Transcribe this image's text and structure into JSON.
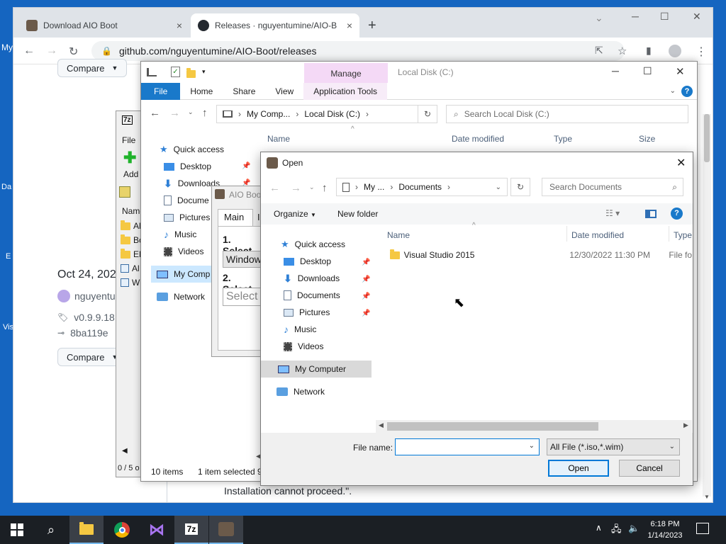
{
  "desktop": {
    "labels": [
      "My",
      "Da",
      "E",
      "Vis"
    ]
  },
  "chrome": {
    "tabs": [
      {
        "title": "Download AIO Boot",
        "close": "×"
      },
      {
        "title": "Releases · nguyentumine/AIO-Bo",
        "close": "×"
      }
    ],
    "new_tab": "+",
    "url": "github.com/nguyentumine/AIO-Boot/releases",
    "window_controls": {
      "min": "─",
      "max": "☐",
      "close": "✕",
      "tabsearch": "⌄"
    },
    "page": {
      "compare_label": "Compare",
      "date": "Oct 24, 2020",
      "author": "nguyentu",
      "tag": "v0.9.9.18",
      "commit": "8ba119e",
      "bottom_text": "Installation cannot proceed.\"."
    }
  },
  "explorer": {
    "title": "Local Disk (C:)",
    "manage_label": "Manage",
    "ribbon_tabs": [
      "File",
      "Home",
      "Share",
      "View",
      "Application Tools"
    ],
    "path": [
      "My Comp...",
      "Local Disk (C:)"
    ],
    "search_placeholder": "Search Local Disk (C:)",
    "columns": [
      "Name",
      "Date modified",
      "Type",
      "Size"
    ],
    "nav": [
      "Quick access",
      "Desktop",
      "Downloads",
      "Docume",
      "Pictures",
      "Music",
      "Videos",
      "My Comp",
      "Network"
    ],
    "status": {
      "items": "10 items",
      "selected": "1 item selected",
      "trail": "9"
    }
  },
  "sevenz": {
    "title_glyph": "7z",
    "menu_file": "File",
    "add_label": "Add",
    "col_name": "Name",
    "rows": [
      "Al",
      "Bo",
      "EF",
      "Al",
      "W"
    ],
    "status": "0 / 5 o"
  },
  "aio": {
    "title": "AIO Boo",
    "tab_main": "Main",
    "tab_other": "I",
    "step1": "1. Select",
    "windows_value": "Windows",
    "step2": "2. Select",
    "select_placeholder": "Select I"
  },
  "open_dialog": {
    "title": "Open",
    "path": [
      "My ...",
      "Documents"
    ],
    "search_placeholder": "Search Documents",
    "organize": "Organize",
    "new_folder": "New folder",
    "columns": {
      "name": "Name",
      "date": "Date modified",
      "type": "Type"
    },
    "nav": [
      "Quick access",
      "Desktop",
      "Downloads",
      "Documents",
      "Pictures",
      "Music",
      "Videos",
      "My Computer",
      "Network"
    ],
    "files": [
      {
        "name": "Visual Studio 2015",
        "date": "12/30/2022 11:30 PM",
        "type": "File fo"
      }
    ],
    "filename_label": "File name:",
    "filename_value": "",
    "filter": "All File (*.iso,*.wim)",
    "open_label": "Open",
    "cancel_label": "Cancel"
  },
  "taskbar": {
    "time": "6:18 PM",
    "date": "1/14/2023",
    "apps": [
      "File Explorer",
      "Chrome",
      "Visual Studio",
      "7-Zip",
      "AIO Boot"
    ]
  }
}
